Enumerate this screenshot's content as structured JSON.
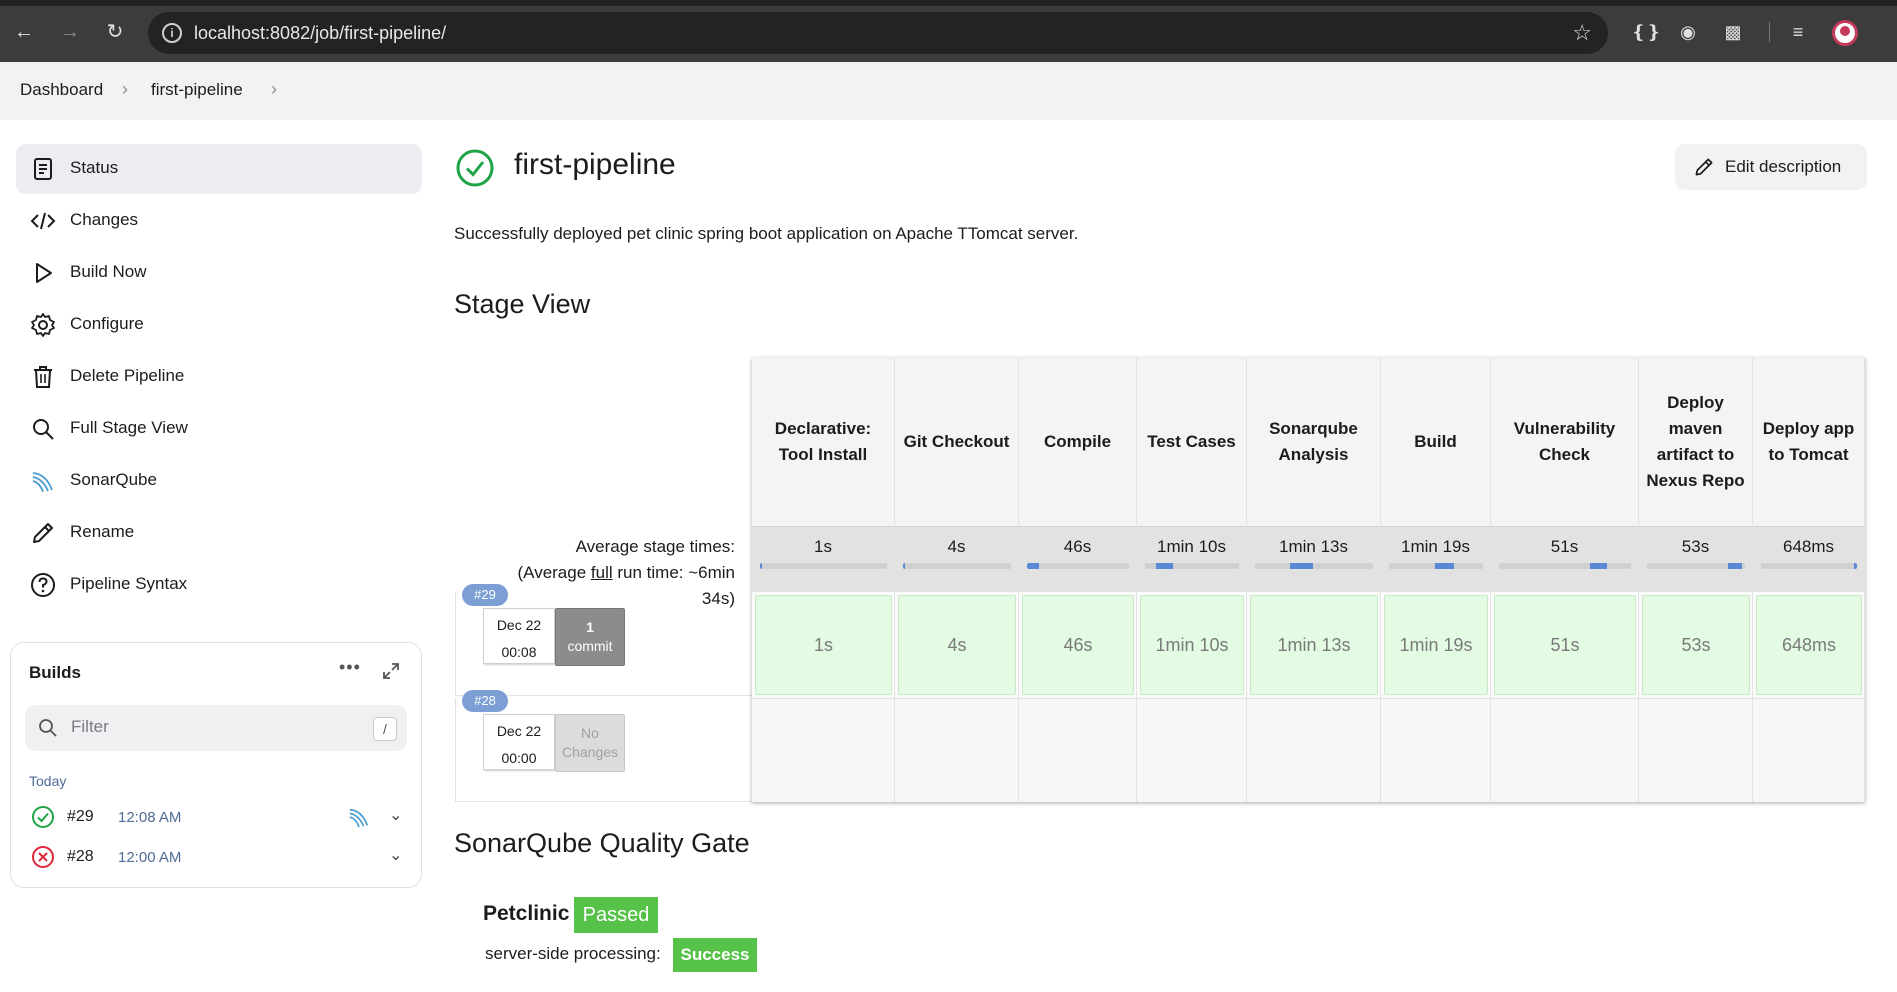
{
  "browser": {
    "url": "localhost:8082/job/first-pipeline/"
  },
  "breadcrumb": [
    "Dashboard",
    "first-pipeline"
  ],
  "sidebar": {
    "items": [
      {
        "label": "Status",
        "icon": "status-document-icon"
      },
      {
        "label": "Changes",
        "icon": "code-brackets-icon"
      },
      {
        "label": "Build Now",
        "icon": "play-icon"
      },
      {
        "label": "Configure",
        "icon": "gear-icon"
      },
      {
        "label": "Delete Pipeline",
        "icon": "trash-icon"
      },
      {
        "label": "Full Stage View",
        "icon": "magnifier-icon"
      },
      {
        "label": "SonarQube",
        "icon": "sonarqube-icon"
      },
      {
        "label": "Rename",
        "icon": "pencil-icon"
      },
      {
        "label": "Pipeline Syntax",
        "icon": "help-circle-icon"
      }
    ]
  },
  "builds": {
    "title": "Builds",
    "filter_placeholder": "Filter",
    "filter_shortcut": "/",
    "group_label": "Today",
    "items": [
      {
        "number": "#29",
        "time": "12:08 AM",
        "status": "success"
      },
      {
        "number": "#28",
        "time": "12:00 AM",
        "status": "failed"
      }
    ]
  },
  "job": {
    "title": "first-pipeline",
    "edit_description_label": "Edit description",
    "description": "Successfully deployed pet clinic spring boot application on Apache TTomcat server."
  },
  "stage_view": {
    "title": "Stage View",
    "avg_label_line1": "Average stage times:",
    "avg_label_prefix": "(Average ",
    "avg_label_link": "full",
    "avg_label_suffix": " run time: ~6min",
    "avg_label_line3": "34s)",
    "stages": [
      {
        "name": "Declarative: Tool Install",
        "avg": "1s",
        "run29": "1s",
        "bar_start": 0.0,
        "bar_fill": 0.0
      },
      {
        "name": "Git Checkout",
        "avg": "4s",
        "run29": "4s",
        "bar_start": 0.0,
        "bar_fill": 0.0
      },
      {
        "name": "Compile",
        "avg": "46s",
        "run29": "46s",
        "bar_start": 0.0,
        "bar_fill": 0.12
      },
      {
        "name": "Test Cases",
        "avg": "1min 10s",
        "run29": "1min 10s",
        "bar_start": 0.12,
        "bar_fill": 0.18
      },
      {
        "name": "Sonarqube Analysis",
        "avg": "1min 13s",
        "run29": "1min 13s",
        "bar_start": 0.3,
        "bar_fill": 0.19
      },
      {
        "name": "Build",
        "avg": "1min 19s",
        "run29": "1min 19s",
        "bar_start": 0.49,
        "bar_fill": 0.2
      },
      {
        "name": "Vulnerability Check",
        "avg": "51s",
        "run29": "51s",
        "bar_start": 0.69,
        "bar_fill": 0.13
      },
      {
        "name": "Deploy maven artifact to Nexus Repo",
        "avg": "53s",
        "run29": "53s",
        "bar_start": 0.83,
        "bar_fill": 0.14
      },
      {
        "name": "Deploy app to Tomcat",
        "avg": "648ms",
        "run29": "648ms",
        "bar_start": 0.97,
        "bar_fill": 0.03
      }
    ],
    "runs": [
      {
        "badge": "#29",
        "date": "Dec 22",
        "time": "00:08",
        "changes_line1": "1",
        "changes_line2": "commit"
      },
      {
        "badge": "#28",
        "date": "Dec 22",
        "time": "00:00",
        "changes_line1": "No",
        "changes_line2": "Changes"
      }
    ]
  },
  "quality_gate": {
    "title": "SonarQube Quality Gate",
    "project": "Petclinic",
    "status": "Passed",
    "processing_label": "server-side processing:",
    "processing_status": "Success"
  },
  "colors": {
    "success_green": "#56c24a",
    "failure_red": "#e0283a",
    "stage_success_bg": "#e2fbe2",
    "bar_fill": "#5a8ad6"
  }
}
